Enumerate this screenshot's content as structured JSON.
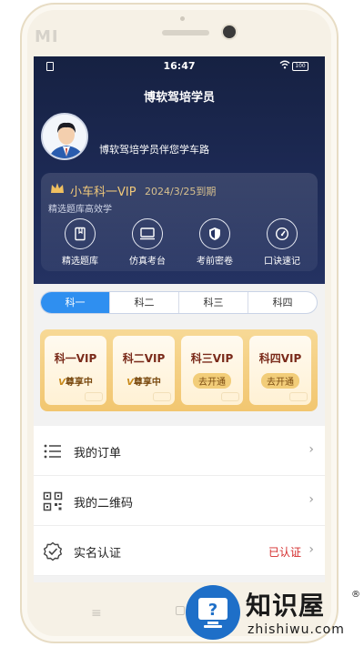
{
  "device": {
    "brand_mark": "MI"
  },
  "status_bar": {
    "time": "16:47",
    "battery": "100"
  },
  "header": {
    "title": "博软驾培学员"
  },
  "profile": {
    "slogan": "博软驾培学员伴您学车路"
  },
  "vip_card": {
    "title": "小车科一VIP",
    "expire": "2024/3/25到期",
    "slogan": "精选题库高效学",
    "features": [
      {
        "label": "精选题库",
        "icon": "book-icon"
      },
      {
        "label": "仿真考台",
        "icon": "monitor-icon"
      },
      {
        "label": "考前密卷",
        "icon": "shield-icon"
      },
      {
        "label": "口诀速记",
        "icon": "gauge-icon"
      }
    ]
  },
  "tabs": [
    {
      "label": "科一",
      "active": true
    },
    {
      "label": "科二",
      "active": false
    },
    {
      "label": "科三",
      "active": false
    },
    {
      "label": "科四",
      "active": false
    }
  ],
  "vip_tiles": [
    {
      "name": "科一VIP",
      "status": "尊享中",
      "state": "using"
    },
    {
      "name": "科二VIP",
      "status": "尊享中",
      "state": "using"
    },
    {
      "name": "科三VIP",
      "status": "去开通",
      "state": "open"
    },
    {
      "name": "科四VIP",
      "status": "去开通",
      "state": "open"
    }
  ],
  "menu": [
    {
      "label": "我的订单",
      "icon": "list-icon",
      "value": ""
    },
    {
      "label": "我的二维码",
      "icon": "qrcode-icon",
      "value": ""
    },
    {
      "label": "实名认证",
      "icon": "verified-icon",
      "value": "已认证"
    }
  ],
  "watermark": {
    "title": "知识屋",
    "reg": "®",
    "subtitle": "zhishiwu.com"
  },
  "colors": {
    "hero": "#1d2a55",
    "accent": "#2f8ff0",
    "gold": "#f2c670",
    "verified": "#d42a2a"
  }
}
